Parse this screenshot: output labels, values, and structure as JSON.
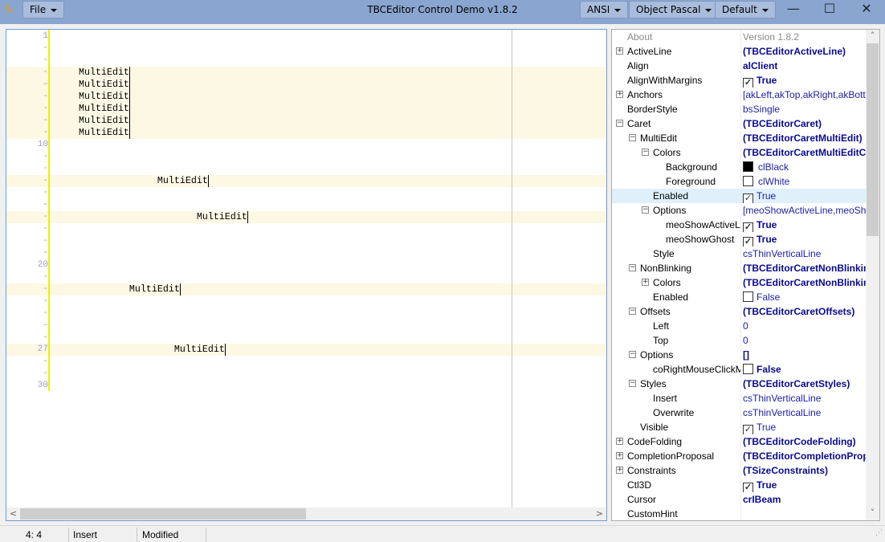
{
  "titlebar": {
    "title": "TBCEditor Control Demo v1.8.2",
    "file_menu": "File",
    "encoding": "ANSI",
    "highlighter": "Object Pascal",
    "color_scheme": "Default",
    "minimize": "—",
    "maximize": "☐",
    "close": "✕"
  },
  "editor": {
    "lines": [
      {
        "marker": "1",
        "text": "",
        "hl": false
      },
      {
        "marker": "-",
        "text": "",
        "hl": false
      },
      {
        "marker": "-",
        "text": "",
        "hl": false
      },
      {
        "marker": "-",
        "text": "     MultiEdit",
        "hl": true,
        "caret": true
      },
      {
        "marker": "–",
        "text": "     MultiEdit",
        "hl": true,
        "caret": true
      },
      {
        "marker": "-",
        "text": "     MultiEdit",
        "hl": true,
        "caret": true
      },
      {
        "marker": "-",
        "text": "     MultiEdit",
        "hl": true,
        "caret": true
      },
      {
        "marker": "-",
        "text": "     MultiEdit",
        "hl": true,
        "caret": true
      },
      {
        "marker": "-",
        "text": "     MultiEdit",
        "hl": true,
        "caret": true
      },
      {
        "marker": "10",
        "text": "",
        "hl": false
      },
      {
        "marker": "-",
        "text": "",
        "hl": false
      },
      {
        "marker": "-",
        "text": "",
        "hl": false
      },
      {
        "marker": "-",
        "text": "                   MultiEdit",
        "hl": true,
        "caret": true
      },
      {
        "marker": "-",
        "text": "",
        "hl": false
      },
      {
        "marker": "–",
        "text": "",
        "hl": false
      },
      {
        "marker": "-",
        "text": "                          MultiEdit",
        "hl": true,
        "caret": true
      },
      {
        "marker": "-",
        "text": "",
        "hl": false
      },
      {
        "marker": "-",
        "text": "",
        "hl": false
      },
      {
        "marker": "-",
        "text": "",
        "hl": false
      },
      {
        "marker": "20",
        "text": "",
        "hl": false
      },
      {
        "marker": "-",
        "text": "",
        "hl": false
      },
      {
        "marker": "-",
        "text": "              MultiEdit",
        "hl": true,
        "caret": true
      },
      {
        "marker": "-",
        "text": "",
        "hl": false
      },
      {
        "marker": "-",
        "text": "",
        "hl": false
      },
      {
        "marker": "–",
        "text": "",
        "hl": false
      },
      {
        "marker": "-",
        "text": "",
        "hl": false
      },
      {
        "marker": "27",
        "text": "                      MultiEdit",
        "hl": true,
        "caret": true
      },
      {
        "marker": "-",
        "text": "",
        "hl": false
      },
      {
        "marker": "-",
        "text": "",
        "hl": false
      },
      {
        "marker": "30",
        "text": "",
        "hl": false
      }
    ]
  },
  "inspector": {
    "rows": [
      {
        "name": "About",
        "value": "Version 1.8.2",
        "level": 0,
        "exp": "",
        "style": "gray"
      },
      {
        "name": "ActiveLine",
        "value": "(TBCEditorActiveLine)",
        "level": 0,
        "exp": "+",
        "style": "b"
      },
      {
        "name": "Align",
        "value": "alClient",
        "level": 0,
        "exp": "",
        "style": "b"
      },
      {
        "name": "AlignWithMargins",
        "value": "True",
        "level": 0,
        "exp": "",
        "style": "b",
        "check": true
      },
      {
        "name": "Anchors",
        "value": "[akLeft,akTop,akRight,akBottom]",
        "level": 0,
        "exp": "+",
        "style": ""
      },
      {
        "name": "BorderStyle",
        "value": "bsSingle",
        "level": 0,
        "exp": "",
        "style": ""
      },
      {
        "name": "Caret",
        "value": "(TBCEditorCaret)",
        "level": 0,
        "exp": "−",
        "style": "b"
      },
      {
        "name": "MultiEdit",
        "value": "(TBCEditorCaretMultiEdit)",
        "level": 1,
        "exp": "−",
        "style": "b"
      },
      {
        "name": "Colors",
        "value": "(TBCEditorCaretMultiEditColors)",
        "level": 2,
        "exp": "−",
        "style": "b"
      },
      {
        "name": "Background",
        "value": "clBlack",
        "level": 3,
        "exp": "",
        "style": "",
        "swatch": "#000000"
      },
      {
        "name": "Foreground",
        "value": "clWhite",
        "level": 3,
        "exp": "",
        "style": "",
        "swatch": "#ffffff"
      },
      {
        "name": "Enabled",
        "value": "True",
        "level": 2,
        "exp": "",
        "style": "",
        "check": true,
        "selected": true
      },
      {
        "name": "Options",
        "value": "[meoShowActiveLine,meoShowGhost]",
        "level": 2,
        "exp": "−",
        "style": ""
      },
      {
        "name": "meoShowActiveLine",
        "value": "True",
        "level": 3,
        "exp": "",
        "style": "b",
        "check": true
      },
      {
        "name": "meoShowGhost",
        "value": "True",
        "level": 3,
        "exp": "",
        "style": "b",
        "check": true
      },
      {
        "name": "Style",
        "value": "csThinVerticalLine",
        "level": 2,
        "exp": "",
        "style": ""
      },
      {
        "name": "NonBlinking",
        "value": "(TBCEditorCaretNonBlinking)",
        "level": 1,
        "exp": "−",
        "style": "b"
      },
      {
        "name": "Colors",
        "value": "(TBCEditorCaretNonBlinkingColors)",
        "level": 2,
        "exp": "+",
        "style": "b"
      },
      {
        "name": "Enabled",
        "value": "False",
        "level": 2,
        "exp": "",
        "style": "",
        "check": false
      },
      {
        "name": "Offsets",
        "value": "(TBCEditorCaretOffsets)",
        "level": 1,
        "exp": "−",
        "style": "b"
      },
      {
        "name": "Left",
        "value": "0",
        "level": 2,
        "exp": "",
        "style": ""
      },
      {
        "name": "Top",
        "value": "0",
        "level": 2,
        "exp": "",
        "style": ""
      },
      {
        "name": "Options",
        "value": "[]",
        "level": 1,
        "exp": "−",
        "style": "b"
      },
      {
        "name": "coRightMouseClickMovesCaret",
        "value": "False",
        "level": 2,
        "exp": "",
        "style": "b",
        "check": false
      },
      {
        "name": "Styles",
        "value": "(TBCEditorCaretStyles)",
        "level": 1,
        "exp": "−",
        "style": "b"
      },
      {
        "name": "Insert",
        "value": "csThinVerticalLine",
        "level": 2,
        "exp": "",
        "style": ""
      },
      {
        "name": "Overwrite",
        "value": "csThinVerticalLine",
        "level": 2,
        "exp": "",
        "style": ""
      },
      {
        "name": "Visible",
        "value": "True",
        "level": 1,
        "exp": "",
        "style": "",
        "check": true
      },
      {
        "name": "CodeFolding",
        "value": "(TBCEditorCodeFolding)",
        "level": 0,
        "exp": "+",
        "style": "b"
      },
      {
        "name": "CompletionProposal",
        "value": "(TBCEditorCompletionProposal)",
        "level": 0,
        "exp": "+",
        "style": "b"
      },
      {
        "name": "Constraints",
        "value": "(TSizeConstraints)",
        "level": 0,
        "exp": "+",
        "style": "b"
      },
      {
        "name": "Ctl3D",
        "value": "True",
        "level": 0,
        "exp": "",
        "style": "b",
        "check": true
      },
      {
        "name": "Cursor",
        "value": "crIBeam",
        "level": 0,
        "exp": "",
        "style": "b"
      },
      {
        "name": "CustomHint",
        "value": "",
        "level": 0,
        "exp": "",
        "style": ""
      }
    ]
  },
  "statusbar": {
    "position": "4: 4",
    "mode": "Insert",
    "state": "Modified"
  }
}
